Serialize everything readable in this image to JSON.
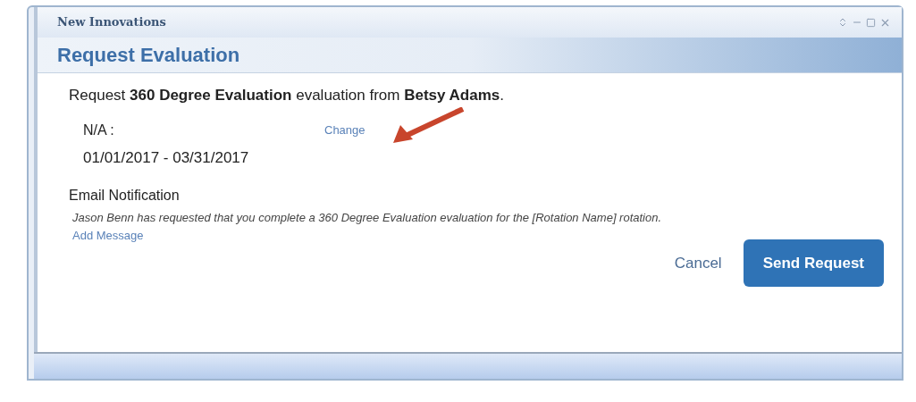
{
  "window": {
    "title": "New Innovations"
  },
  "dialog": {
    "heading": "Request Evaluation",
    "sentence": "Request **360 Degree Evaluation** evaluation from **Betsy Adams**.",
    "period_label": "N/A :",
    "change_link": "Change",
    "dates": "01/01/2017 - 03/31/2017",
    "email_heading": "Email Notification",
    "email_text": "Jason Benn has requested that you complete a 360 Degree Evaluation evaluation for the [Rotation Name] rotation.",
    "add_message_link": "Add Message",
    "buttons": [
      {
        "label": "Cancel",
        "kind": "link"
      },
      {
        "label": "Send Request",
        "kind": "primary"
      }
    ]
  }
}
